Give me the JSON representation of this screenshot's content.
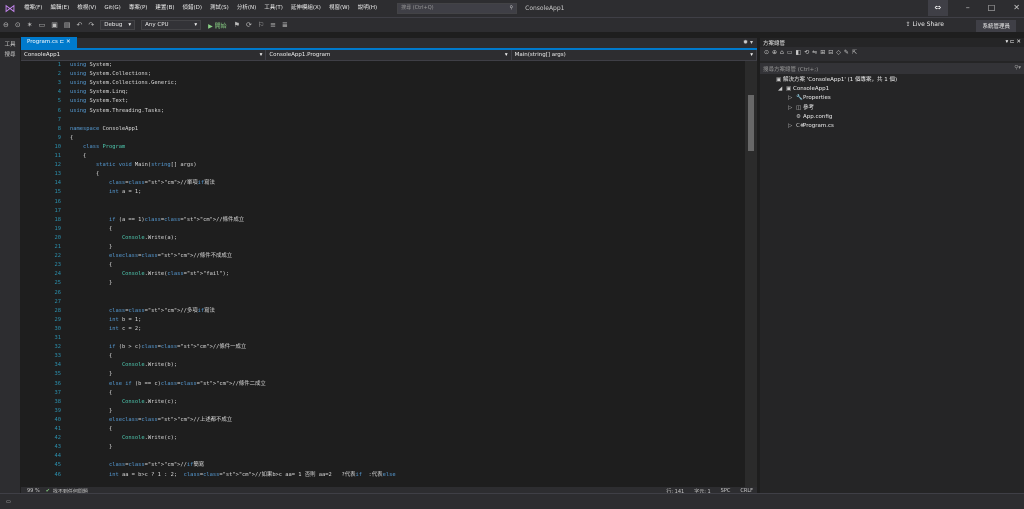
{
  "menubar": {
    "items": [
      "檔案(F)",
      "編輯(E)",
      "檢視(V)",
      "Git(G)",
      "專案(P)",
      "建置(B)",
      "偵錯(D)",
      "測試(S)",
      "分析(N)",
      "工具(T)",
      "延伸模組(X)",
      "視窗(W)",
      "說明(H)"
    ],
    "search_placeholder": "搜尋 (Ctrl+Q)",
    "app_title": "ConsoleApp1"
  },
  "toolbar": {
    "config": "Debug",
    "platform": "Any CPU",
    "start": "開始",
    "live_share": "Live Share",
    "admin": "系統管理員"
  },
  "left_tabs": [
    "工具",
    "搜尋"
  ],
  "editor": {
    "tab": "Program.cs",
    "nav": [
      "ConsoleApp1",
      "ConsoleApp1.Program",
      "Main(string[] args)"
    ],
    "lines": [
      {
        "n": "1",
        "t": "using System;"
      },
      {
        "n": "2",
        "t": "using System.Collections;"
      },
      {
        "n": "3",
        "t": "using System.Collections.Generic;"
      },
      {
        "n": "4",
        "t": "using System.Linq;"
      },
      {
        "n": "5",
        "t": "using System.Text;"
      },
      {
        "n": "6",
        "t": "using System.Threading.Tasks;"
      },
      {
        "n": "7",
        "t": ""
      },
      {
        "n": "8",
        "t": "namespace ConsoleApp1"
      },
      {
        "n": "9",
        "t": "{"
      },
      {
        "n": "10",
        "t": "    class Program"
      },
      {
        "n": "11",
        "t": "    {"
      },
      {
        "n": "12",
        "t": "        static void Main(string[] args)"
      },
      {
        "n": "13",
        "t": "        {"
      },
      {
        "n": "14",
        "t": "            //單項if寫法"
      },
      {
        "n": "15",
        "t": "            int a = 1;"
      },
      {
        "n": "16",
        "t": ""
      },
      {
        "n": "17",
        "t": ""
      },
      {
        "n": "18",
        "t": "            if (a == 1)//條件成立"
      },
      {
        "n": "19",
        "t": "            {"
      },
      {
        "n": "20",
        "t": "                Console.Write(a);"
      },
      {
        "n": "21",
        "t": "            }"
      },
      {
        "n": "22",
        "t": "            else//條件不成成立"
      },
      {
        "n": "23",
        "t": "            {"
      },
      {
        "n": "24",
        "t": "                Console.Write(\"fail\");"
      },
      {
        "n": "25",
        "t": "            }"
      },
      {
        "n": "26",
        "t": ""
      },
      {
        "n": "27",
        "t": ""
      },
      {
        "n": "28",
        "t": "            //多項if寫法"
      },
      {
        "n": "29",
        "t": "            int b = 1;"
      },
      {
        "n": "30",
        "t": "            int c = 2;"
      },
      {
        "n": "31",
        "t": ""
      },
      {
        "n": "32",
        "t": "            if (b > c)//條件一成立"
      },
      {
        "n": "33",
        "t": "            {"
      },
      {
        "n": "34",
        "t": "                Console.Write(b);"
      },
      {
        "n": "35",
        "t": "            }"
      },
      {
        "n": "36",
        "t": "            else if (b == c)//條件二成立"
      },
      {
        "n": "37",
        "t": "            {"
      },
      {
        "n": "38",
        "t": "                Console.Write(c);"
      },
      {
        "n": "39",
        "t": "            }"
      },
      {
        "n": "40",
        "t": "            else//上述都不成立"
      },
      {
        "n": "41",
        "t": "            {"
      },
      {
        "n": "42",
        "t": "                Console.Write(c);"
      },
      {
        "n": "43",
        "t": "            }"
      },
      {
        "n": "44",
        "t": ""
      },
      {
        "n": "45",
        "t": "            //if簡寫"
      },
      {
        "n": "46",
        "t": "            int aa = b>c ? 1 : 2;  //如果b>c aa= 1 否則 aa=2   ?代表if  :代表else"
      }
    ]
  },
  "status": {
    "zoom": "99 %",
    "issues": "找不到任何問題",
    "line": "行: 141",
    "char": "字元: 1",
    "spc": "SPC",
    "crlf": "CRLF"
  },
  "solution": {
    "title": "方案總管",
    "search": "搜尋方案總管 (Ctrl+;)",
    "nodes": [
      {
        "label": "解決方案 'ConsoleApp1' (1 個專案，共 1 個)",
        "icon": "▣",
        "arrow": ""
      },
      {
        "label": "ConsoleApp1",
        "icon": "▣",
        "arrow": "◢"
      },
      {
        "label": "Properties",
        "icon": "🔧",
        "arrow": "▷"
      },
      {
        "label": "參考",
        "icon": "◫",
        "arrow": "▷"
      },
      {
        "label": "App.config",
        "icon": "⚙",
        "arrow": ""
      },
      {
        "label": "Program.cs",
        "icon": "C#",
        "arrow": "▷"
      }
    ]
  }
}
